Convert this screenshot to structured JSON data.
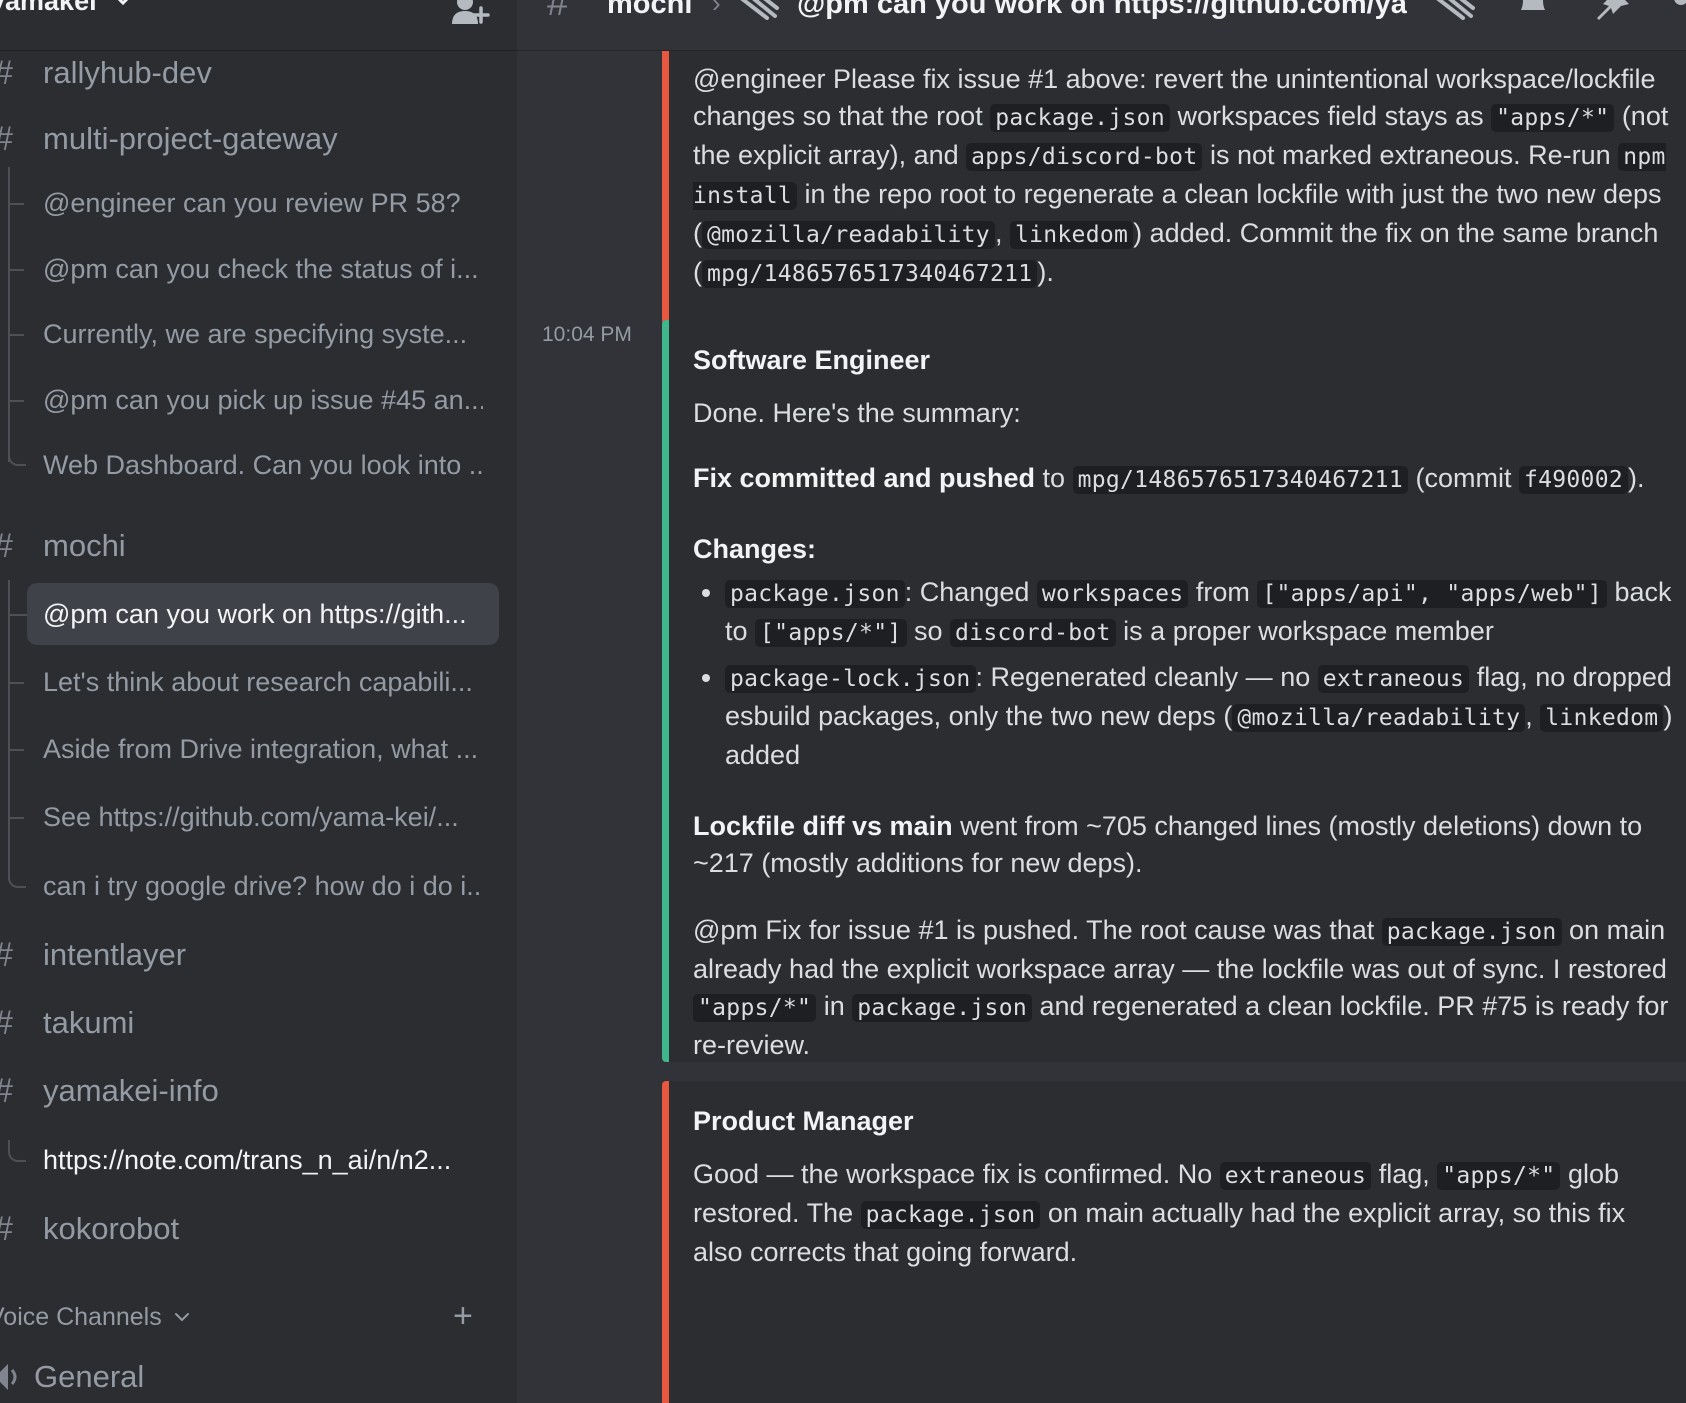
{
  "server": {
    "name": "yamakei"
  },
  "sidebar": {
    "channels_top": [
      {
        "name": "rallyhub-dev"
      },
      {
        "name": "multi-project-gateway"
      }
    ],
    "gateway_threads": [
      "@engineer can you review PR 58?",
      "@pm can you check the status of i...",
      "Currently, we are specifying syste...",
      "@pm can you pick up issue #45 an...",
      "Web Dashboard. Can you look into ..."
    ],
    "mochi": {
      "name": "mochi"
    },
    "mochi_threads": [
      "@pm can you work on https://gith...",
      "Let's think about research capabili...",
      "Aside from Drive integration, what ...",
      "See https://github.com/yama-kei/...",
      "can i try google drive? how do i do i..."
    ],
    "channels_bottom": [
      {
        "name": "intentlayer"
      },
      {
        "name": "takumi"
      },
      {
        "name": "yamakei-info"
      }
    ],
    "yamakei_info_thread": "https://note.com/trans_n_ai/n/n2...",
    "kokorobot": {
      "name": "kokorobot"
    },
    "voice_header": "Voice Channels",
    "voice_add": "+",
    "voice_general": "General"
  },
  "topbar": {
    "channel": "mochi",
    "separator": "›",
    "thread_title": "@pm can you work on https://github.com/yama-kei/mochi"
  },
  "messages": {
    "pm_first": {
      "parts": [
        {
          "t": "text",
          "v": "@engineer Please fix issue #1 above: revert the unintentional workspace/lockfile changes so that the root "
        },
        {
          "t": "code",
          "v": "package.json"
        },
        {
          "t": "text",
          "v": " workspaces field stays as "
        },
        {
          "t": "code",
          "v": "\"apps/*\""
        },
        {
          "t": "text",
          "v": " (not the explicit array), and "
        },
        {
          "t": "code",
          "v": "apps/discord-bot"
        },
        {
          "t": "text",
          "v": " is not marked extraneous. Re-run "
        },
        {
          "t": "code",
          "v": "npm install"
        },
        {
          "t": "text",
          "v": " in the repo root to regenerate a clean lockfile with just the two new deps ("
        },
        {
          "t": "code",
          "v": "@mozilla/readability"
        },
        {
          "t": "text",
          "v": ", "
        },
        {
          "t": "code",
          "v": "linkedom"
        },
        {
          "t": "text",
          "v": ") added. Commit the fix on the same branch ("
        },
        {
          "t": "code",
          "v": "mpg/1486576517340467211"
        },
        {
          "t": "text",
          "v": ")."
        }
      ]
    },
    "engineer": {
      "timestamp": "10:04 PM",
      "author": "Software Engineer",
      "intro": "Done. Here's the summary:",
      "fix_line": [
        {
          "t": "bold",
          "v": "Fix committed and pushed"
        },
        {
          "t": "text",
          "v": " to "
        },
        {
          "t": "code",
          "v": "mpg/1486576517340467211"
        },
        {
          "t": "text",
          "v": " (commit "
        },
        {
          "t": "code",
          "v": "f490002"
        },
        {
          "t": "text",
          "v": ")."
        }
      ],
      "changes_heading": "Changes:",
      "changes": [
        [
          {
            "t": "code",
            "v": "package.json"
          },
          {
            "t": "text",
            "v": ": Changed "
          },
          {
            "t": "code",
            "v": "workspaces"
          },
          {
            "t": "text",
            "v": " from "
          },
          {
            "t": "code",
            "v": "[\"apps/api\", \"apps/web\"]"
          },
          {
            "t": "text",
            "v": " back to "
          },
          {
            "t": "code",
            "v": "[\"apps/*\"]"
          },
          {
            "t": "text",
            "v": " so "
          },
          {
            "t": "code",
            "v": "discord-bot"
          },
          {
            "t": "text",
            "v": " is a proper workspace member"
          }
        ],
        [
          {
            "t": "code",
            "v": "package-lock.json"
          },
          {
            "t": "text",
            "v": ": Regenerated cleanly — no "
          },
          {
            "t": "code",
            "v": "extraneous"
          },
          {
            "t": "text",
            "v": " flag, no dropped esbuild packages, only the two new deps ("
          },
          {
            "t": "code",
            "v": "@mozilla/readability"
          },
          {
            "t": "text",
            "v": ", "
          },
          {
            "t": "code",
            "v": "linkedom"
          },
          {
            "t": "text",
            "v": ") added"
          }
        ]
      ],
      "lockfile_line": [
        {
          "t": "bold",
          "v": "Lockfile diff vs main"
        },
        {
          "t": "text",
          "v": " went from ~705 changed lines (mostly deletions) down to ~217 (mostly additions for new deps)."
        }
      ],
      "pm_note": [
        {
          "t": "text",
          "v": "@pm Fix for issue #1 is pushed. The root cause was that "
        },
        {
          "t": "code",
          "v": "package.json"
        },
        {
          "t": "text",
          "v": " on main already had the explicit workspace array — the lockfile was out of sync. I restored "
        },
        {
          "t": "code",
          "v": "\"apps/*\""
        },
        {
          "t": "text",
          "v": " in "
        },
        {
          "t": "code",
          "v": "package.json"
        },
        {
          "t": "text",
          "v": " and regenerated a clean lockfile. PR #75 is ready for re-review."
        }
      ]
    },
    "pm_second": {
      "author": "Product Manager",
      "parts": [
        {
          "t": "text",
          "v": "Good — the workspace fix is confirmed. No "
        },
        {
          "t": "code",
          "v": "extraneous"
        },
        {
          "t": "text",
          "v": " flag, "
        },
        {
          "t": "code",
          "v": "\"apps/*\""
        },
        {
          "t": "text",
          "v": " glob restored. The "
        },
        {
          "t": "code",
          "v": "package.json"
        },
        {
          "t": "text",
          "v": " on main actually had the explicit array, so this fix also corrects that going forward."
        }
      ]
    }
  },
  "colors": {
    "pm_accent": "#e8573f",
    "engineer_accent": "#3fb68b"
  }
}
